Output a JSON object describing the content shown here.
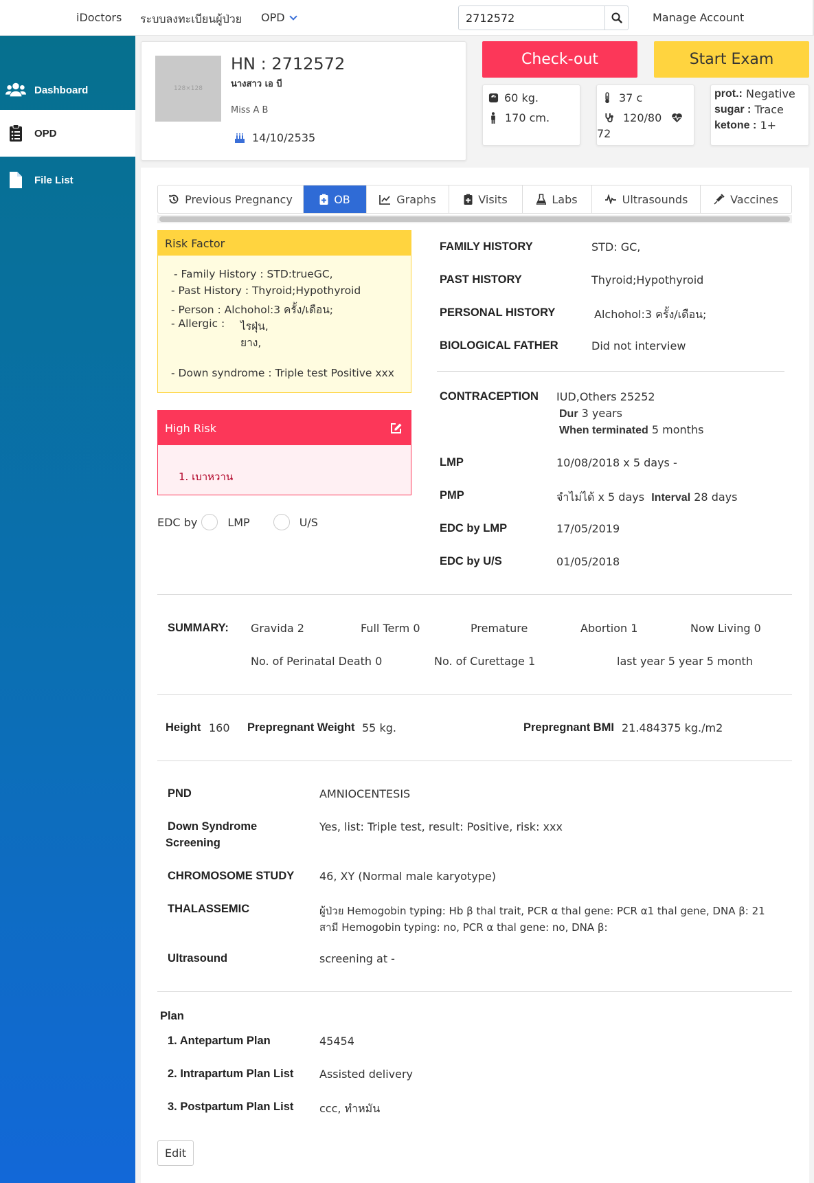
{
  "nav": {
    "brand": "iDoctors",
    "register": "ระบบลงทะเบียนผู้ป่วย",
    "opd": "OPD",
    "search_value": "2712572",
    "manage": "Manage Account"
  },
  "sidebar": {
    "items": [
      {
        "label": "Dashboard",
        "icon": "users-icon"
      },
      {
        "label": "OPD",
        "icon": "clipboard-icon"
      },
      {
        "label": "File List",
        "icon": "file-icon"
      }
    ]
  },
  "patient": {
    "avatar_text": "128×128",
    "hn": "HN : 2712572",
    "thai_name": "นางสาว เอ บี",
    "eng_name": "Miss A B",
    "dob": "14/10/2535"
  },
  "buttons": {
    "checkout": "Check-out",
    "start_exam": "Start Exam",
    "edit": "Edit"
  },
  "vitals": {
    "weight": "60 kg.",
    "height": "170 cm.",
    "temp": "37 c",
    "bp": "120/80",
    "pulse": "72",
    "prot_label": "prot.:",
    "prot_value": "Negative",
    "sugar_label": "sugar :",
    "sugar_value": "Trace",
    "ketone_label": "ketone :",
    "ketone_value": "1+"
  },
  "tabs": [
    {
      "label": "Previous Pregnancy",
      "icon": "history-icon",
      "active": false
    },
    {
      "label": "OB",
      "icon": "medical-clipboard-icon",
      "active": true
    },
    {
      "label": "Graphs",
      "icon": "line-chart-icon",
      "active": false
    },
    {
      "label": "Visits",
      "icon": "clipboard-plus-icon",
      "active": false
    },
    {
      "label": "Labs",
      "icon": "flask-icon",
      "active": false
    },
    {
      "label": "Ultrasounds",
      "icon": "pulse-wave-icon",
      "active": false
    },
    {
      "label": "Vaccines",
      "icon": "syringe-icon",
      "active": false
    }
  ],
  "risk_factor": {
    "title": "Risk Factor",
    "family": "- Family History :  STD:trueGC,",
    "past": "- Past History :  Thyroid;Hypothyroid",
    "person": "- Person :  Alchohol:3 ครั้ง/เดือน;",
    "allergic_label": "- Allergic :",
    "allergic_1": "ไรฝุ่น,",
    "allergic_2": "ยาง,",
    "down": "- Down syndrome : Triple test Positive xxx"
  },
  "high_risk": {
    "title": "High Risk",
    "item_1": "1.  เบาหวาน"
  },
  "edc": {
    "label": "EDC by",
    "opt_lmp": "LMP",
    "opt_us": "U/S"
  },
  "history": {
    "family_label": "FAMILY HISTORY",
    "family_value": "STD: GC,",
    "past_label": "PAST HISTORY",
    "past_value": "Thyroid;Hypothyroid",
    "personal_label": "PERSONAL HISTORY",
    "personal_value": "Alchohol:3 ครั้ง/เดือน;",
    "father_label": "BIOLOGICAL FATHER",
    "father_value": "Did not interview"
  },
  "contraception": {
    "label": "CONTRACEPTION",
    "value": "IUD,Others 25252",
    "dur_label": "Dur",
    "dur_value": "3 years",
    "term_label": "When terminated",
    "term_value": "5 months"
  },
  "dates": {
    "lmp_label": "LMP",
    "lmp_value": "10/08/2018 x 5 days  -",
    "pmp_label": "PMP",
    "pmp_value": "จำไม่ได้ x 5 days",
    "interval_label": "Interval",
    "interval_value": "28 days",
    "edc_lmp_label": "EDC by LMP",
    "edc_lmp_value": "17/05/2019",
    "edc_us_label": "EDC by U/S",
    "edc_us_value": "01/05/2018"
  },
  "summary": {
    "label": "SUMMARY:",
    "gravida": "Gravida 2",
    "full_term": "Full Term 0",
    "premature": "Premature",
    "abortion": "Abortion 1",
    "now_living": "Now Living 0",
    "perinatal": "No. of Perinatal Death 0",
    "curettage": "No. of Curettage 1",
    "last_year": "last year 5 year 5 month"
  },
  "body": {
    "height_label": "Height",
    "height_value": "160",
    "pre_weight_label": "Prepregnant Weight",
    "pre_weight_value": "55 kg.",
    "bmi_label": "Prepregnant BMI",
    "bmi_value": "21.484375 kg./m2"
  },
  "screening": {
    "pnd_label": "PND",
    "pnd_value": "AMNIOCENTESIS",
    "down_label_1": "Down Syndrome",
    "down_label_2": "Screening",
    "down_value": "Yes, list: Triple test, result: Positive, risk: xxx",
    "chromo_label": "CHROMOSOME STUDY",
    "chromo_value": "46, XY (Normal male karyotype)",
    "thal_label": "THALASSEMIC",
    "thal_value_1": "ผู้ป่วย   Hemogobin typing: Hb β thal trait, PCR α thal gene: PCR α1 thal gene, DNA β: 21",
    "thal_value_2": "สามี   Hemogobin typing: no, PCR α thal gene: no, DNA β:",
    "us_label": "Ultrasound",
    "us_value": "screening at -"
  },
  "plan": {
    "title": "Plan",
    "ante_label": "1. Antepartum Plan",
    "ante_value": "45454",
    "intra_label": "2. Intrapartum Plan List",
    "intra_value": "Assisted delivery",
    "post_label": "3. Postpartum Plan List",
    "post_value": "ccc, ทำหมัน"
  },
  "colors": {
    "sidebar_top": "#06708e",
    "sidebar_bottom": "#1268d8",
    "checkout": "#fc3759",
    "start_exam": "#ffd43f",
    "tab_active": "#2f6bd6"
  }
}
